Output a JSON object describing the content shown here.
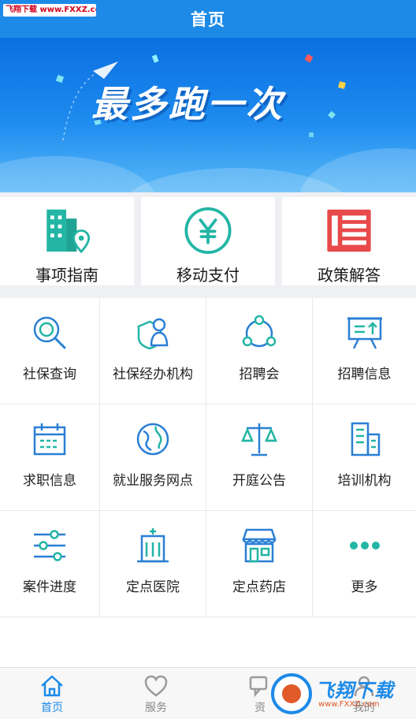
{
  "watermark_top": "飞翔下载 www.FXXZ.com",
  "header": {
    "title": "首页"
  },
  "banner": {
    "slogan": "最多跑一次"
  },
  "feature_cards": [
    {
      "label": "事项指南",
      "icon": "building-location-icon"
    },
    {
      "label": "移动支付",
      "icon": "yuan-coin-icon"
    },
    {
      "label": "政策解答",
      "icon": "document-list-icon"
    }
  ],
  "services": [
    {
      "label": "社保查询",
      "icon": "magnifier-icon"
    },
    {
      "label": "社保经办机构",
      "icon": "shield-person-icon"
    },
    {
      "label": "招聘会",
      "icon": "network-circle-icon"
    },
    {
      "label": "招聘信息",
      "icon": "presentation-board-icon"
    },
    {
      "label": "求职信息",
      "icon": "calendar-icon"
    },
    {
      "label": "就业服务网点",
      "icon": "globe-icon"
    },
    {
      "label": "开庭公告",
      "icon": "scales-icon"
    },
    {
      "label": "培训机构",
      "icon": "office-buildings-icon"
    },
    {
      "label": "案件进度",
      "icon": "sliders-icon"
    },
    {
      "label": "定点医院",
      "icon": "hospital-icon"
    },
    {
      "label": "定点药店",
      "icon": "store-icon"
    },
    {
      "label": "更多",
      "icon": "more-dots-icon"
    }
  ],
  "tabs": [
    {
      "label": "首页",
      "icon": "home-icon",
      "active": true
    },
    {
      "label": "服务",
      "icon": "heart-icon",
      "active": false
    },
    {
      "label": "资",
      "icon": "chat-icon",
      "active": false
    },
    {
      "label": "我的",
      "icon": "person-icon",
      "active": false
    }
  ],
  "watermark_bottom": {
    "text": "飞翔下载",
    "url": "www.FXXZ.com"
  },
  "colors": {
    "primary": "#1d8ae8",
    "teal": "#23b5a5",
    "red": "#e8494a",
    "icon_blue": "#2a7fd4"
  }
}
